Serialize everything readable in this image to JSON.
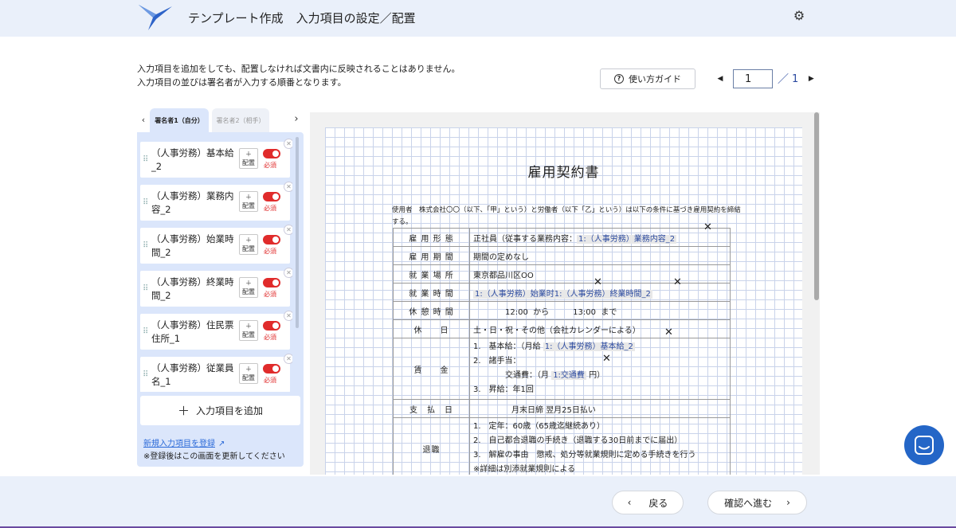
{
  "header": {
    "title": "テンプレート作成",
    "subtitle": "入力項目の設定／配置",
    "settings_icon": "gear-icon",
    "logo_icon": "bird-logo-icon"
  },
  "intro": {
    "line1": "入力項目を追加をしても、配置しなければ文書内に反映されることはありません。",
    "line2": "入力項目の並びは署名者が入力する順番となります。"
  },
  "guide_button": {
    "label": "使い方ガイド",
    "icon": "help-circle-icon"
  },
  "pager": {
    "current": "1",
    "separator": "／",
    "total": "1"
  },
  "signer_tabs": [
    {
      "label": "署名者1（自分）",
      "active": true
    },
    {
      "label": "署名者2（相手）",
      "active": false
    }
  ],
  "items": [
    {
      "label": "（人事労務）基本給_2",
      "place": "＋\n配置",
      "required": "必須"
    },
    {
      "label": "（人事労務）業務内容_2",
      "place": "＋\n配置",
      "required": "必須"
    },
    {
      "label": "（人事労務）始業時間_2",
      "place": "＋\n配置",
      "required": "必須"
    },
    {
      "label": "（人事労務）終業時間_2",
      "place": "＋\n配置",
      "required": "必須"
    },
    {
      "label": "（人事労務）住民票住所_1",
      "place": "＋\n配置",
      "required": "必須"
    },
    {
      "label": "（人事労務）従業員名_1",
      "place": "＋\n配置",
      "required": "必須"
    }
  ],
  "item_place_label": "配置",
  "item_place_plus": "＋",
  "add_button": {
    "label": "入力項目を追加",
    "plus": "＋"
  },
  "new_item_link": "新規入力項目を登録",
  "refresh_note": "※登録後はこの画面を更新してください",
  "document": {
    "title": "雇用契約書",
    "intro": "使用者　株式会社〇〇（以下、「甲」という）と労働者（以下「乙」という）は以下の条件に基づき雇用契約を締結する。",
    "rows": {
      "employment_type": {
        "key": "雇 用 形 態",
        "text": "正社員（従事する業務内容：",
        "field": "1:（人事労務）業務内容_2"
      },
      "period": {
        "key": "雇 用 期 間",
        "text": "期間の定めなし"
      },
      "place": {
        "key": "就 業 場 所",
        "text": "東京都品川区OO"
      },
      "hours": {
        "key": "就 業 時 間",
        "field_start": "1:（人事労務）始業时1:（人事労務）終業時間_2"
      },
      "break": {
        "key": "休 憩 時 間",
        "text": "12:00  から　　　13:00  まで"
      },
      "holidays": {
        "key": "休　　日",
        "text": "土・日・祝・その他（会社カレンダーによる）"
      },
      "wages": {
        "key": "賃　　金",
        "line1_prefix": "1.　基本給：（月給",
        "line1_field": "1:（人事労務）基本給_2",
        "line2": "2.　諸手当：",
        "line3_prefix": "交通費：（月",
        "line3_field": "1:交通費",
        "line3_suffix": "円）",
        "line4": "3.　昇給：年1回"
      },
      "payday": {
        "key": "支　払　日",
        "text": "月末日締 翌月25日払い"
      },
      "retirement": {
        "key": "退職",
        "line1": "1.　定年：60歳（65歳迄継続あり）",
        "line2": "2.　自己都合退職の手続き（退職する30日前までに届出）",
        "line3": "3.　解雇の事由　懲戒、処分等就業規則に定める手続きを行う",
        "line4": "※詳細は別添就業規則による"
      }
    }
  },
  "footer": {
    "back_label": "戻る",
    "next_label": "確認へ進む"
  },
  "colors": {
    "header_bg": "#eaf0fa",
    "panel_bg": "#dbe6fb",
    "required_red": "#e02b2b",
    "field_blue": "#2b4aa0",
    "chat_blue": "#2466c7"
  }
}
